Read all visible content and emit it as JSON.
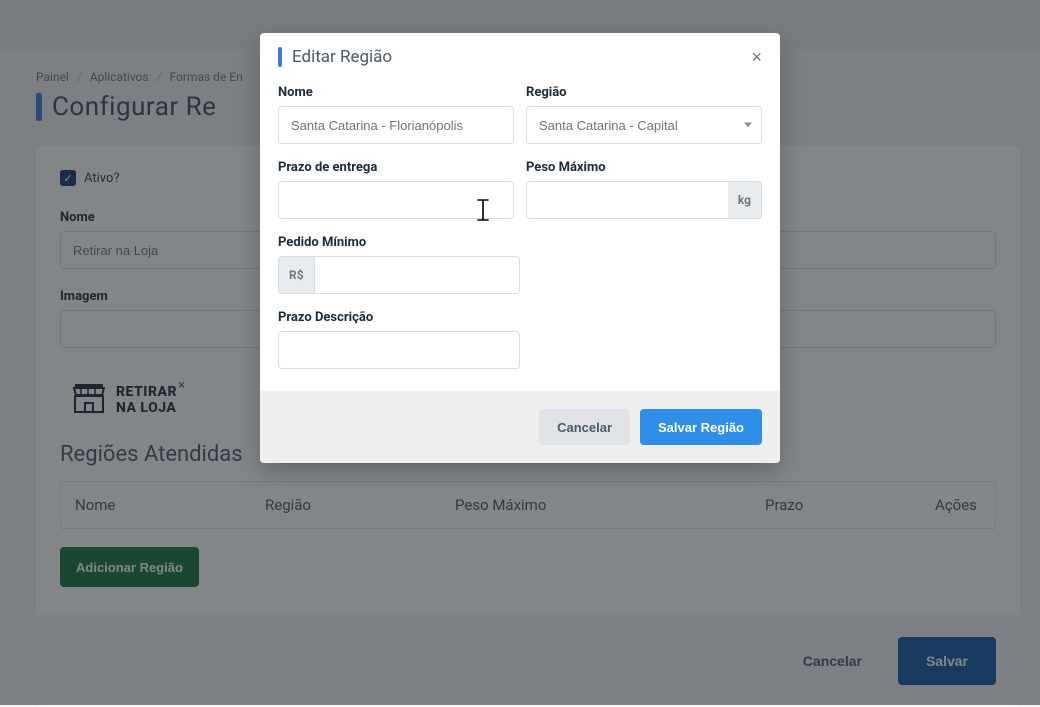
{
  "breadcrumb": {
    "item0": "Painel",
    "item1": "Aplicativos",
    "item2": "Formas de En"
  },
  "page": {
    "title": "Configurar Re"
  },
  "bg": {
    "ativo_label": "Ativo?",
    "nome_label": "Nome",
    "nome_value": "Retirar na Loja",
    "imagem_label": "Imagem",
    "store_text_line1": "RETIRAR",
    "store_text_line2": "NA LOJA",
    "section_title": "Regiões Atendidas",
    "table": {
      "col_nome": "Nome",
      "col_regiao": "Região",
      "col_peso": "Peso Máximo",
      "col_prazo": "Prazo",
      "col_acoes": "Ações"
    },
    "btn_add": "Adicionar Região",
    "btn_cancel": "Cancelar",
    "btn_save": "Salvar"
  },
  "modal": {
    "title": "Editar Região",
    "labels": {
      "nome": "Nome",
      "regiao": "Região",
      "prazo": "Prazo de entrega",
      "peso": "Peso Máximo",
      "pedido_min": "Pedido Mínimo",
      "prazo_desc": "Prazo Descrição"
    },
    "values": {
      "nome": "Santa Catarina - Florianópolis",
      "regiao": "Santa Catarina - Capital",
      "prazo": "",
      "peso": "",
      "pedido_min": "",
      "prazo_desc": ""
    },
    "addons": {
      "kg": "kg",
      "rs": "R$"
    },
    "btn_cancel": "Cancelar",
    "btn_save": "Salvar Região"
  }
}
